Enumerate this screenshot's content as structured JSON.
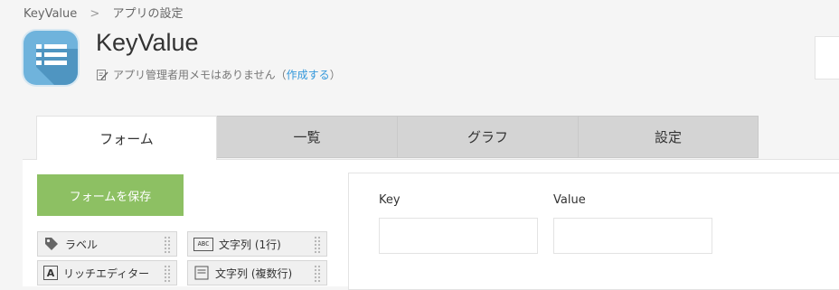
{
  "breadcrumb": {
    "root": "KeyValue",
    "separator": ">",
    "current": "アプリの設定"
  },
  "app": {
    "title": "KeyValue",
    "memo_text": "アプリ管理者用メモはありません",
    "memo_paren_open": "（",
    "memo_link": "作成する",
    "memo_paren_close": "）",
    "icon": "list-icon",
    "icon_color": "#6fb3dc"
  },
  "tabs": [
    {
      "label": "フォーム",
      "active": true
    },
    {
      "label": "一覧",
      "active": false
    },
    {
      "label": "グラフ",
      "active": false
    },
    {
      "label": "設定",
      "active": false
    }
  ],
  "form_editor": {
    "save_label": "フォームを保存",
    "save_color": "#8dc063",
    "palette": [
      {
        "label": "ラベル",
        "icon": "tag-icon"
      },
      {
        "label": "文字列 (1行)",
        "icon": "abc-icon",
        "icon_text": "ABC"
      },
      {
        "label": "リッチエディター",
        "icon": "rich-text-icon",
        "icon_text": "A"
      },
      {
        "label": "文字列 (複数行)",
        "icon": "multiline-text-icon"
      }
    ],
    "fields": [
      {
        "label": "Key",
        "value": ""
      },
      {
        "label": "Value",
        "value": ""
      }
    ]
  }
}
